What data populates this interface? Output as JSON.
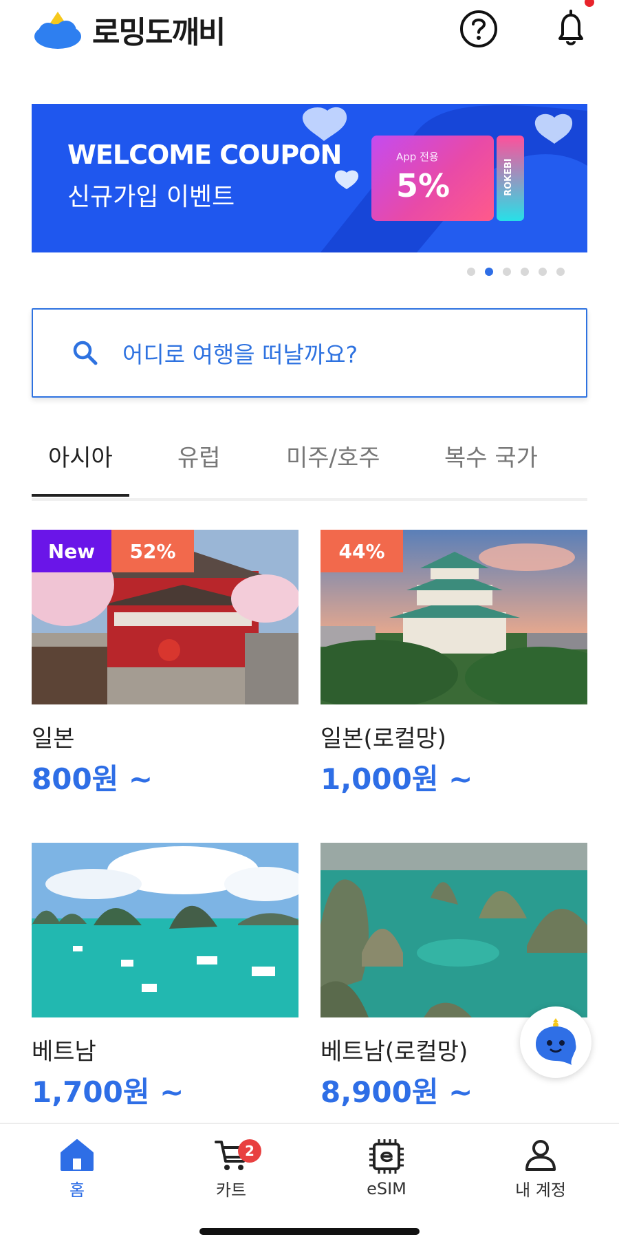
{
  "header": {
    "logo_text": "로밍도깨비",
    "help_icon": "question-circle-icon",
    "bell_icon": "bell-icon"
  },
  "banner": {
    "title": "WELCOME COUPON",
    "subtitle": "신규가입 이벤트",
    "coupon_small": "App 전용",
    "coupon_big": "5%",
    "coupon_stub": "ROKEBI",
    "page_count": 6,
    "active_index": 1
  },
  "search": {
    "placeholder": "어디로 여행을 떠날까요?"
  },
  "tabs": [
    {
      "label": "아시아",
      "active": true
    },
    {
      "label": "유럽",
      "active": false
    },
    {
      "label": "미주/호주",
      "active": false
    },
    {
      "label": "복수 국가",
      "active": false
    }
  ],
  "products": [
    {
      "name": "일본",
      "price": "800원 ~",
      "badge_new": "New",
      "discount": "52%"
    },
    {
      "name": "일본(로컬망)",
      "price": "1,000원 ~",
      "discount": "44%"
    },
    {
      "name": "베트남",
      "price": "1,700원 ~"
    },
    {
      "name": "베트남(로컬망)",
      "price": "8,900원 ~"
    }
  ],
  "nav": {
    "home": "홈",
    "cart": "카트",
    "cart_count": "2",
    "esim": "eSIM",
    "account": "내 계정"
  },
  "colors": {
    "accent": "#2e6ee6",
    "banner": "#1f57ee",
    "new_badge": "#6a15e8",
    "discount_badge": "#f2694c"
  }
}
